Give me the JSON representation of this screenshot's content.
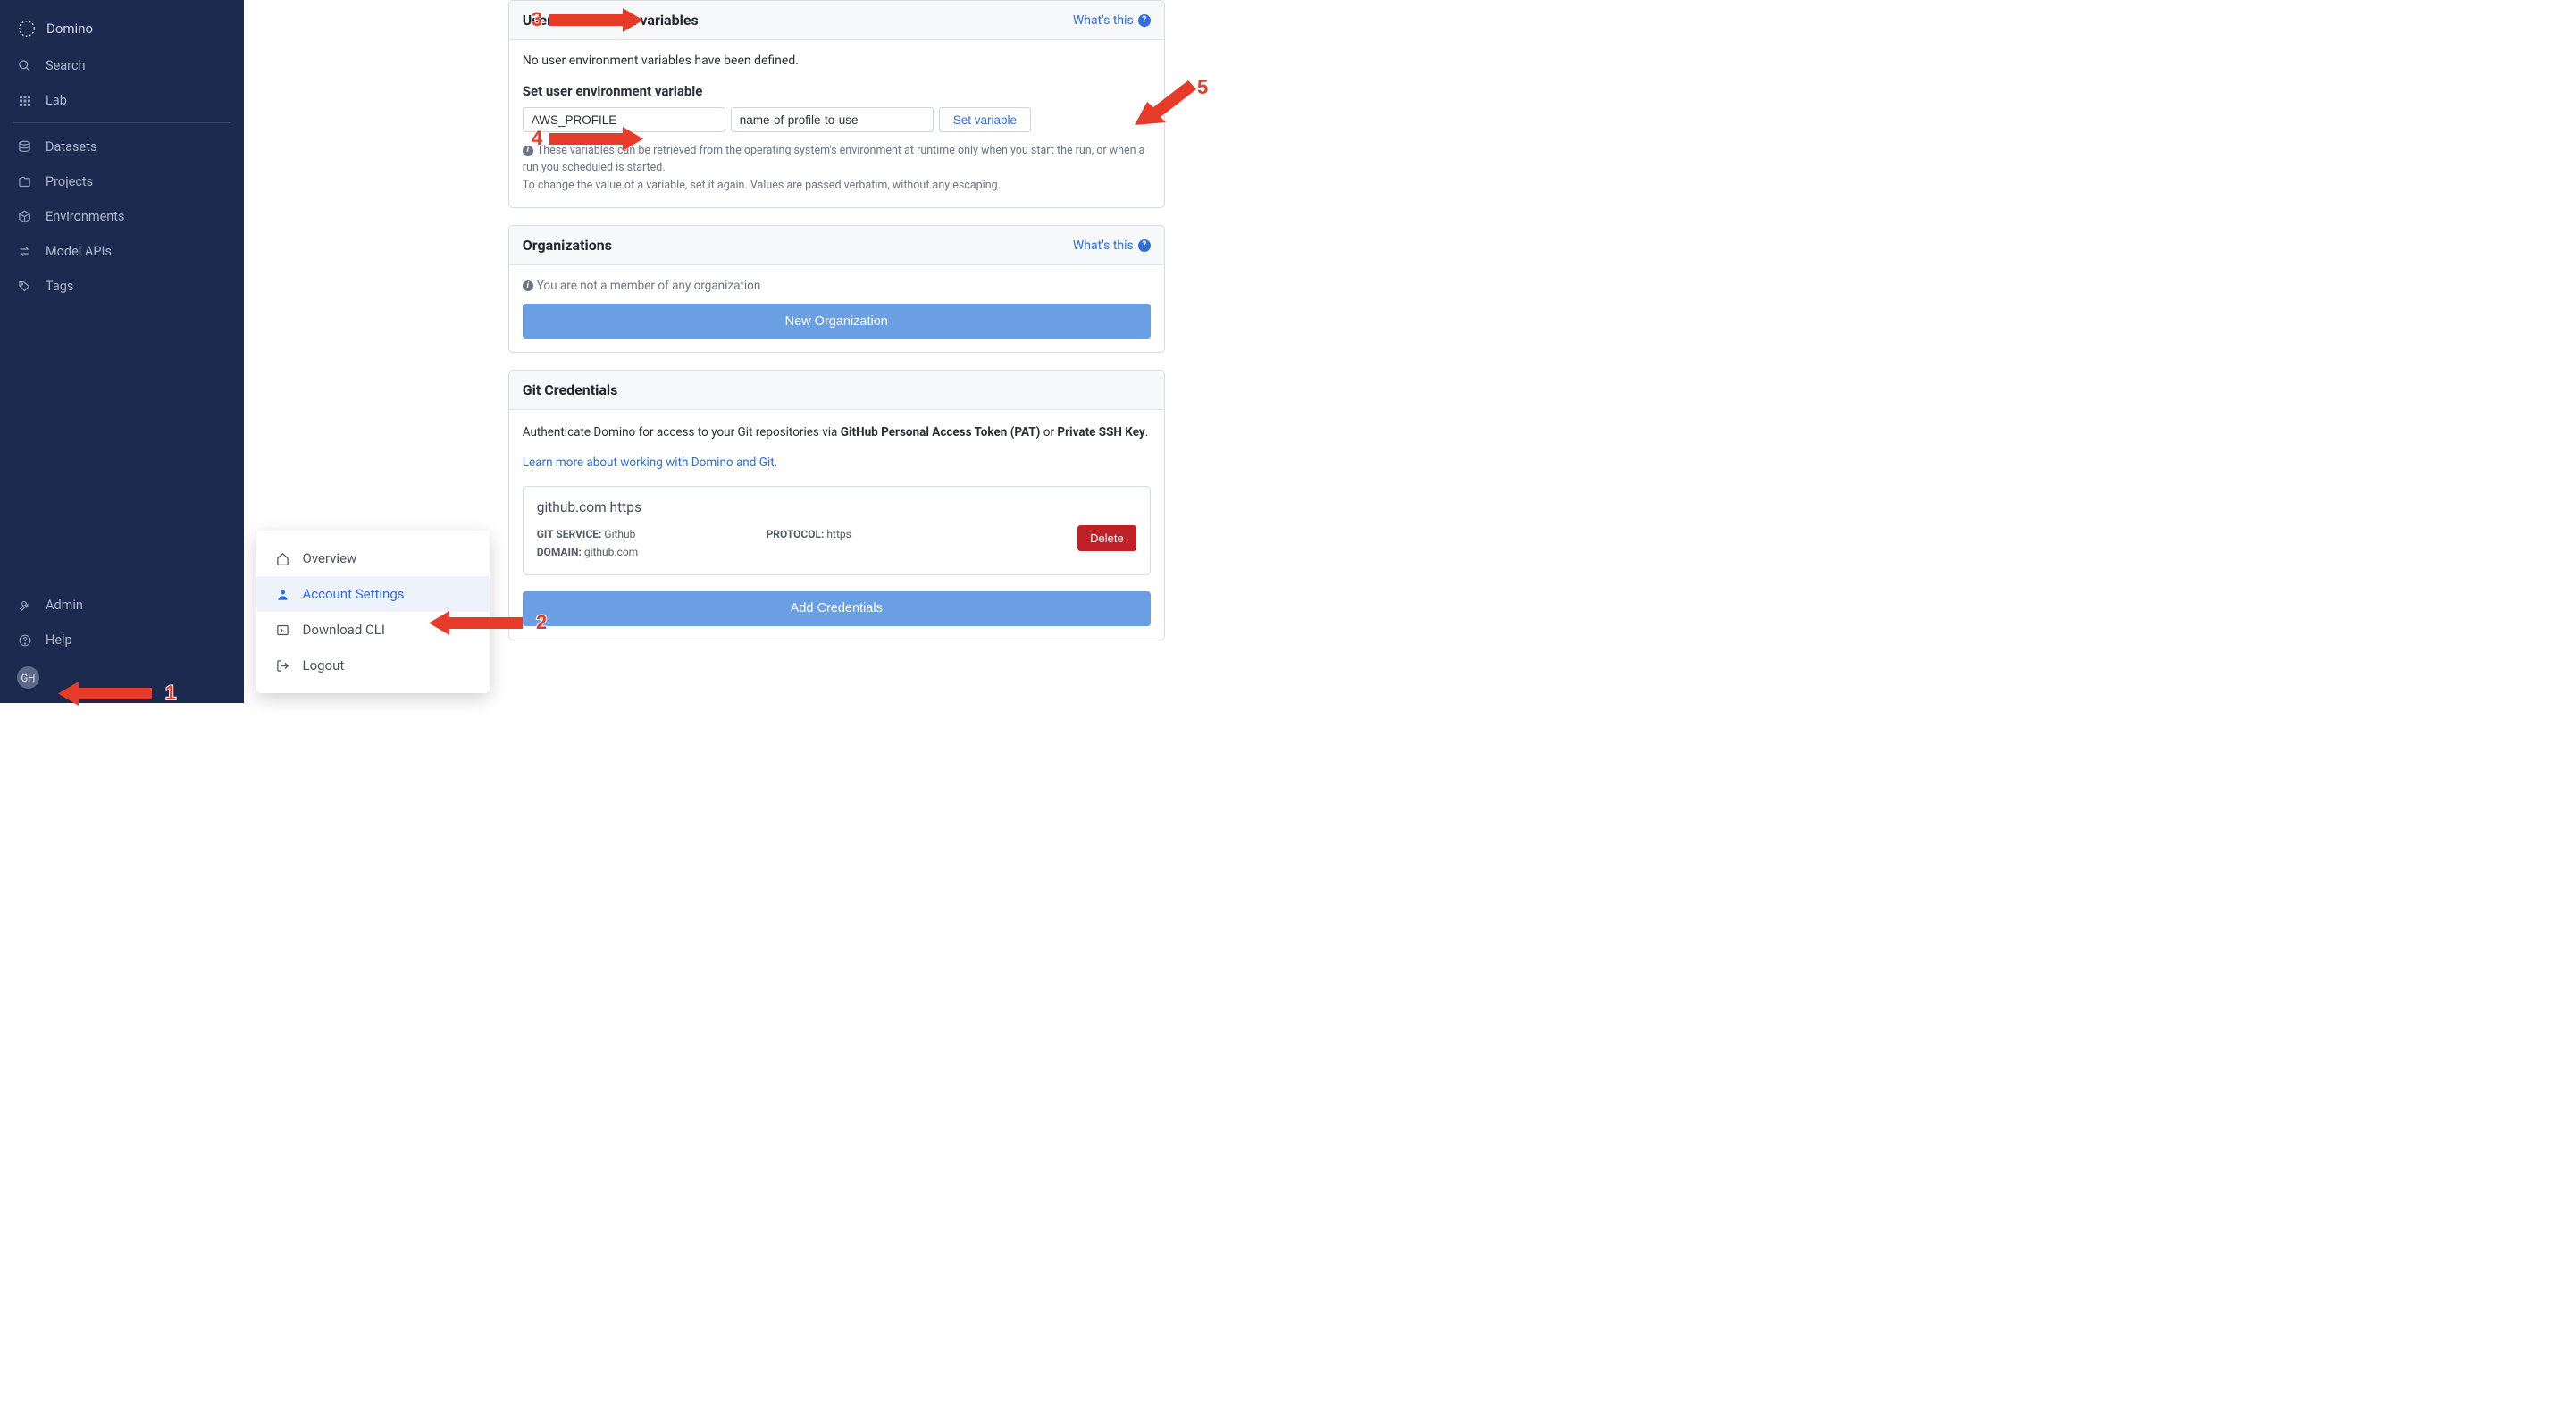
{
  "sidebar": {
    "brand": "Domino",
    "items": [
      {
        "label": "Search",
        "icon": "search-icon"
      },
      {
        "label": "Lab",
        "icon": "apps-icon"
      },
      {
        "label": "Datasets",
        "icon": "database-icon"
      },
      {
        "label": "Projects",
        "icon": "folder-icon"
      },
      {
        "label": "Environments",
        "icon": "cube-icon"
      },
      {
        "label": "Model APIs",
        "icon": "swap-icon"
      },
      {
        "label": "Tags",
        "icon": "tag-icon"
      }
    ],
    "footer": [
      {
        "label": "Admin",
        "icon": "wrench-icon"
      },
      {
        "label": "Help",
        "icon": "help-icon"
      }
    ],
    "user_initials": "GH"
  },
  "user_menu": {
    "items": [
      {
        "label": "Overview",
        "icon": "home-icon"
      },
      {
        "label": "Account Settings",
        "icon": "person-icon",
        "active": true
      },
      {
        "label": "Download CLI",
        "icon": "terminal-icon"
      },
      {
        "label": "Logout",
        "icon": "logout-icon"
      }
    ]
  },
  "panels": {
    "env": {
      "title": "User environment variables",
      "whats_this": "What's this",
      "empty_msg": "No user environment variables have been defined.",
      "subtitle": "Set user environment variable",
      "name_value": "AWS_PROFILE",
      "value_value": "name-of-profile-to-use",
      "set_btn": "Set variable",
      "help1": "These variables can be retrieved from the operating system's environment at runtime only when you start the run, or when a run you scheduled is started.",
      "help2": "To change the value of a variable, set it again. Values are passed verbatim, without any escaping."
    },
    "orgs": {
      "title": "Organizations",
      "whats_this": "What's this",
      "empty_msg": "You are not a member of any organization",
      "new_btn": "New Organization"
    },
    "git": {
      "title": "Git Credentials",
      "auth_pre": "Authenticate Domino for access to your Git repositories via ",
      "auth_bold1": "GitHub Personal Access Token (PAT)",
      "auth_or": " or ",
      "auth_bold2": "Private SSH Key",
      "auth_post": ".",
      "learn_link": "Learn more about working with Domino and Git.",
      "cred": {
        "name": "github.com https",
        "service_label": "GIT SERVICE:",
        "service_value": "Github",
        "domain_label": "DOMAIN:",
        "domain_value": "github.com",
        "protocol_label": "PROTOCOL:",
        "protocol_value": "https",
        "delete_btn": "Delete"
      },
      "add_btn": "Add Credentials"
    }
  },
  "annotations": {
    "1": "1",
    "2": "2",
    "3": "3",
    "4": "4",
    "5": "5"
  }
}
